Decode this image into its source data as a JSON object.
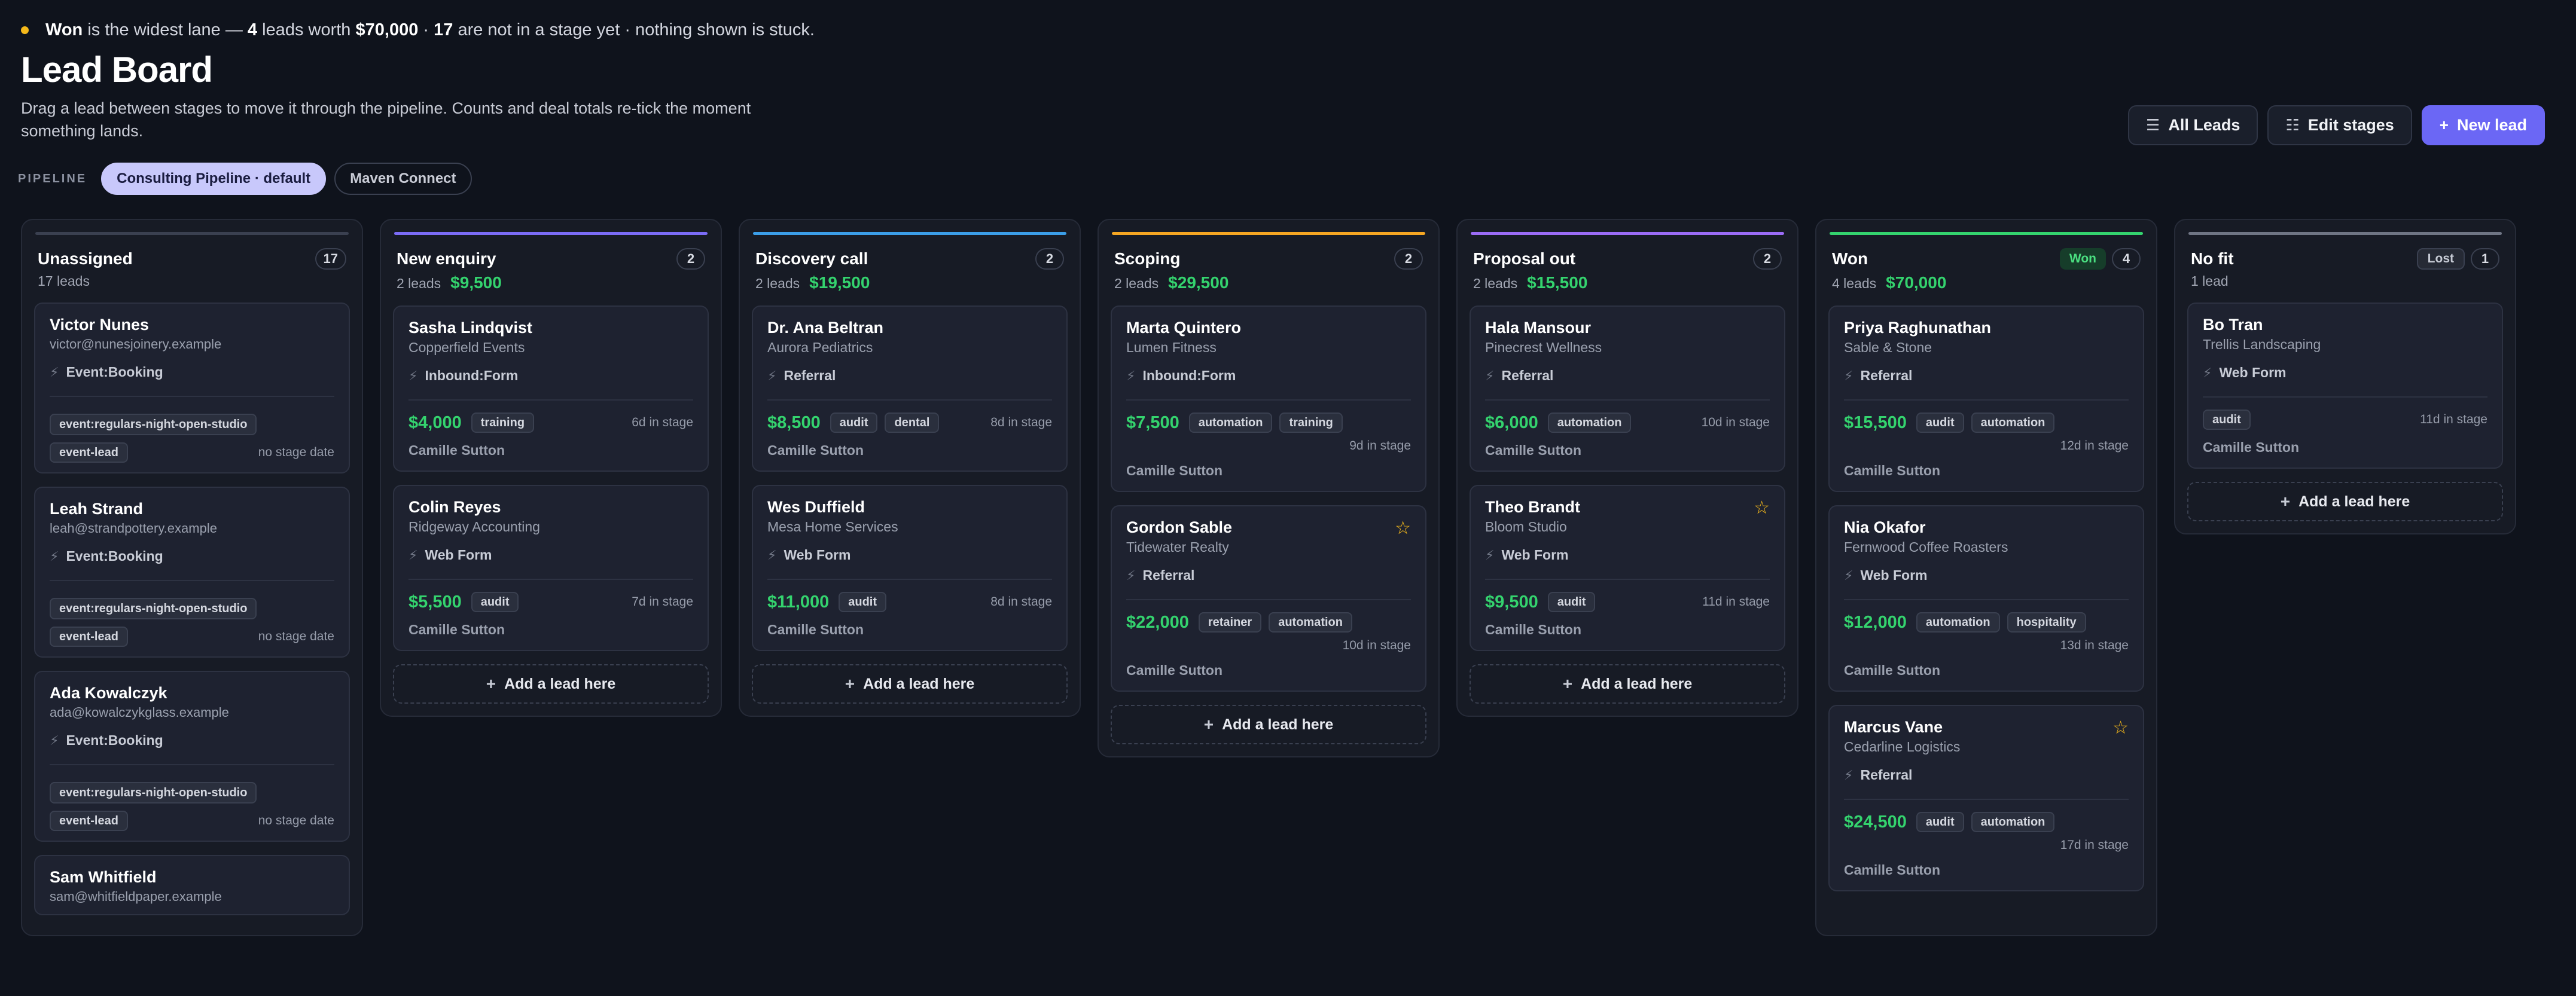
{
  "summary": {
    "lane": "Won",
    "text1": "is the widest lane —",
    "lead_count": "4",
    "text2": "leads worth",
    "amount": "$70,000",
    "sep": "·",
    "unstaged": "17",
    "text3": "are not in a stage yet · nothing shown is stuck."
  },
  "header": {
    "title": "Lead Board",
    "subtitle": "Drag a lead between stages to move it through the pipeline. Counts and deal totals re-tick the moment something lands."
  },
  "actions": {
    "all_leads": "All Leads",
    "edit_stages": "Edit stages",
    "new_lead": "New lead"
  },
  "pipeline": {
    "label": "PIPELINE",
    "options": [
      "Consulting Pipeline · default",
      "Maven Connect"
    ]
  },
  "add_label": "Add a lead here",
  "colors": {
    "accent": "#6b67f5",
    "new_enquiry": "#7b6cf6",
    "discovery": "#3b9ee8",
    "scoping": "#f5a623",
    "proposal": "#9b6cf6",
    "won": "#34d36e",
    "nofit": "#6f7584"
  },
  "columns": {
    "unassigned": {
      "title": "Unassigned",
      "count": "17",
      "sub": "17 leads",
      "leads": [
        {
          "name": "Victor Nunes",
          "email": "victor@nunesjoinery.example",
          "source": "Event:Booking",
          "event": "event:regulars-night-open-studio",
          "tag": "event-lead",
          "stage": "no stage date"
        },
        {
          "name": "Leah Strand",
          "email": "leah@strandpottery.example",
          "source": "Event:Booking",
          "event": "event:regulars-night-open-studio",
          "tag": "event-lead",
          "stage": "no stage date"
        },
        {
          "name": "Ada Kowalczyk",
          "email": "ada@kowalczykglass.example",
          "source": "Event:Booking",
          "event": "event:regulars-night-open-studio",
          "tag": "event-lead",
          "stage": "no stage date"
        },
        {
          "name": "Sam Whitfield",
          "email": "sam@whitfieldpaper.example"
        }
      ]
    },
    "new_enquiry": {
      "title": "New enquiry",
      "count": "2",
      "sub": "2 leads",
      "total": "$9,500",
      "leads": [
        {
          "name": "Sasha Lindqvist",
          "company": "Copperfield Events",
          "source": "Inbound:Form",
          "amount": "$4,000",
          "tags": [
            "training"
          ],
          "days": "6d in stage",
          "owner": "Camille Sutton"
        },
        {
          "name": "Colin Reyes",
          "company": "Ridgeway Accounting",
          "source": "Web Form",
          "amount": "$5,500",
          "tags": [
            "audit"
          ],
          "days": "7d in stage",
          "owner": "Camille Sutton"
        }
      ]
    },
    "discovery": {
      "title": "Discovery call",
      "count": "2",
      "sub": "2 leads",
      "total": "$19,500",
      "leads": [
        {
          "name": "Dr. Ana Beltran",
          "company": "Aurora Pediatrics",
          "source": "Referral",
          "amount": "$8,500",
          "tags": [
            "audit",
            "dental"
          ],
          "days": "8d in stage",
          "owner": "Camille Sutton"
        },
        {
          "name": "Wes Duffield",
          "company": "Mesa Home Services",
          "source": "Web Form",
          "amount": "$11,000",
          "tags": [
            "audit"
          ],
          "days": "8d in stage",
          "owner": "Camille Sutton"
        }
      ]
    },
    "scoping": {
      "title": "Scoping",
      "count": "2",
      "sub": "2 leads",
      "total": "$29,500",
      "leads": [
        {
          "name": "Marta Quintero",
          "company": "Lumen Fitness",
          "source": "Inbound:Form",
          "amount": "$7,500",
          "tags": [
            "automation",
            "training"
          ],
          "days": "9d in stage",
          "owner": "Camille Sutton"
        },
        {
          "name": "Gordon Sable",
          "company": "Tidewater Realty",
          "source": "Referral",
          "amount": "$22,000",
          "tags": [
            "retainer",
            "automation"
          ],
          "days": "10d in stage",
          "owner": "Camille Sutton",
          "starred": true
        }
      ]
    },
    "proposal": {
      "title": "Proposal out",
      "count": "2",
      "sub": "2 leads",
      "total": "$15,500",
      "leads": [
        {
          "name": "Hala Mansour",
          "company": "Pinecrest Wellness",
          "source": "Referral",
          "amount": "$6,000",
          "tags": [
            "automation"
          ],
          "days": "10d in stage",
          "owner": "Camille Sutton"
        },
        {
          "name": "Theo Brandt",
          "company": "Bloom Studio",
          "source": "Web Form",
          "amount": "$9,500",
          "tags": [
            "audit"
          ],
          "days": "11d in stage",
          "owner": "Camille Sutton",
          "starred": true
        }
      ]
    },
    "won": {
      "title": "Won",
      "badge": "Won",
      "count": "4",
      "sub": "4 leads",
      "total": "$70,000",
      "leads": [
        {
          "name": "Priya Raghunathan",
          "company": "Sable & Stone",
          "source": "Referral",
          "amount": "$15,500",
          "tags": [
            "audit",
            "automation"
          ],
          "days": "12d in stage",
          "owner": "Camille Sutton"
        },
        {
          "name": "Nia Okafor",
          "company": "Fernwood Coffee Roasters",
          "source": "Web Form",
          "amount": "$12,000",
          "tags": [
            "automation",
            "hospitality"
          ],
          "days": "13d in stage",
          "owner": "Camille Sutton"
        },
        {
          "name": "Marcus Vane",
          "company": "Cedarline Logistics",
          "source": "Referral",
          "amount": "$24,500",
          "tags": [
            "audit",
            "automation"
          ],
          "days": "17d in stage",
          "owner": "Camille Sutton",
          "starred": true
        }
      ]
    },
    "nofit": {
      "title": "No fit",
      "badge": "Lost",
      "count": "1",
      "sub": "1 lead",
      "leads": [
        {
          "name": "Bo Tran",
          "company": "Trellis Landscaping",
          "source": "Web Form",
          "tags": [
            "audit"
          ],
          "days": "11d in stage",
          "owner": "Camille Sutton"
        }
      ]
    }
  }
}
